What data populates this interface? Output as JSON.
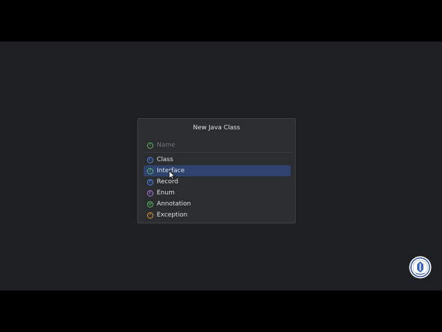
{
  "dialog": {
    "title": "New Java Class",
    "name_placeholder": "Name",
    "name_value": "",
    "name_icon": "interface-icon"
  },
  "items": [
    {
      "label": "Class",
      "icon": "class-icon",
      "letter": "C",
      "color": "#548af7",
      "selected": false
    },
    {
      "label": "Interface",
      "icon": "interface-icon",
      "letter": "I",
      "color": "#5fb865",
      "selected": true
    },
    {
      "label": "Record",
      "icon": "record-icon",
      "letter": "R",
      "color": "#548af7",
      "selected": false
    },
    {
      "label": "Enum",
      "icon": "enum-icon",
      "letter": "E",
      "color": "#b07fe3",
      "selected": false
    },
    {
      "label": "Annotation",
      "icon": "annotation-icon",
      "letter": "@",
      "color": "#5fb865",
      "selected": false
    },
    {
      "label": "Exception",
      "icon": "exception-icon",
      "letter": "⚡",
      "color": "#e0a13a",
      "selected": false
    }
  ],
  "colors": {
    "background": "#1e1f22",
    "dialog": "#2b2d30",
    "selection": "#2e436e",
    "text": "#dfe1e5",
    "placeholder": "#6f737a"
  }
}
